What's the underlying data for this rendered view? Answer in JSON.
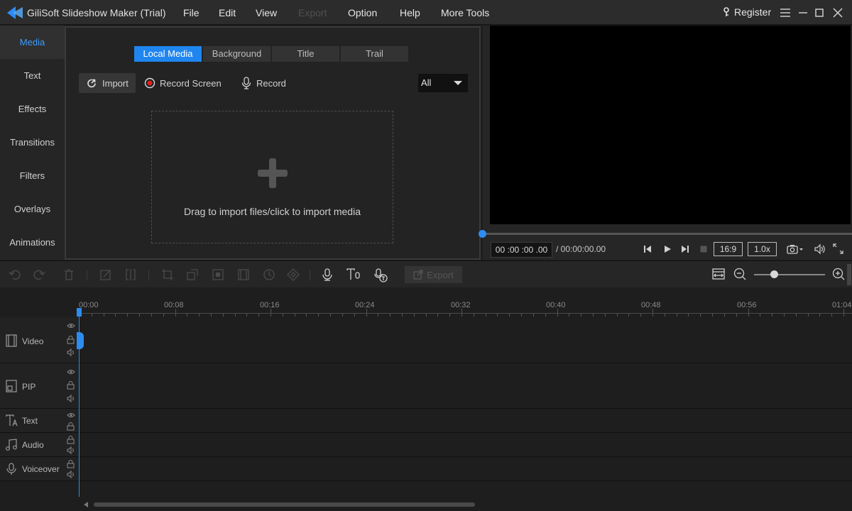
{
  "titlebar": {
    "app_title": "GiliSoft Slideshow Maker (Trial)",
    "menus": [
      "File",
      "Edit",
      "View",
      "Export",
      "Option",
      "Help",
      "More Tools"
    ],
    "register": "Register"
  },
  "sidebar": {
    "items": [
      "Media",
      "Text",
      "Effects",
      "Transitions",
      "Filters",
      "Overlays",
      "Animations"
    ],
    "active": "Media"
  },
  "media": {
    "tabs": [
      "Local Media",
      "Background",
      "Title",
      "Trail"
    ],
    "active_tab": "Local Media",
    "import_label": "Import",
    "record_screen_label": "Record Screen",
    "record_label": "Record",
    "filter_value": "All",
    "drop_text": "Drag to import files/click to import media"
  },
  "preview": {
    "current_time": "00 :00 :00 .00",
    "total_time": "/ 00:00:00.00",
    "aspect_ratio": "16:9",
    "speed": "1.0x",
    "progress": 0
  },
  "timeline": {
    "export_label": "Export",
    "ruler_labels": [
      "00:00",
      "00:08",
      "00:16",
      "00:24",
      "00:32",
      "00:40",
      "00:48",
      "00:56",
      "01:04"
    ],
    "tracks": [
      "Video",
      "PIP",
      "Text",
      "Audio",
      "Voiceover"
    ]
  },
  "colors": {
    "accent": "#2d8cf0",
    "background": "#1e1e1e",
    "record_red": "#e02020"
  }
}
